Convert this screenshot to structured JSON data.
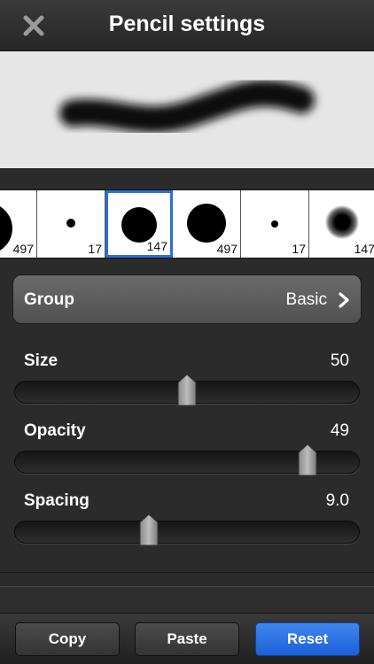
{
  "header": {
    "title": "Pencil settings",
    "close_icon": "close-icon"
  },
  "brushes": [
    {
      "size_label": "497",
      "selected": false
    },
    {
      "size_label": "17",
      "selected": false
    },
    {
      "size_label": "147",
      "selected": true
    },
    {
      "size_label": "497",
      "selected": false
    },
    {
      "size_label": "17",
      "selected": false
    },
    {
      "size_label": "147",
      "selected": false
    }
  ],
  "group": {
    "label": "Group",
    "value": "Basic",
    "chevron_icon": "chevron-right-icon"
  },
  "sliders": {
    "size": {
      "label": "Size",
      "value": "50",
      "fraction": 0.5
    },
    "opacity": {
      "label": "Opacity",
      "value": "49",
      "fraction": 0.85
    },
    "spacing": {
      "label": "Spacing",
      "value": "9.0",
      "fraction": 0.39
    }
  },
  "toolbar": {
    "copy_label": "Copy",
    "paste_label": "Paste",
    "reset_label": "Reset"
  },
  "colors": {
    "accent": "#2c6fd6",
    "reset_button": "#2a72e6"
  }
}
